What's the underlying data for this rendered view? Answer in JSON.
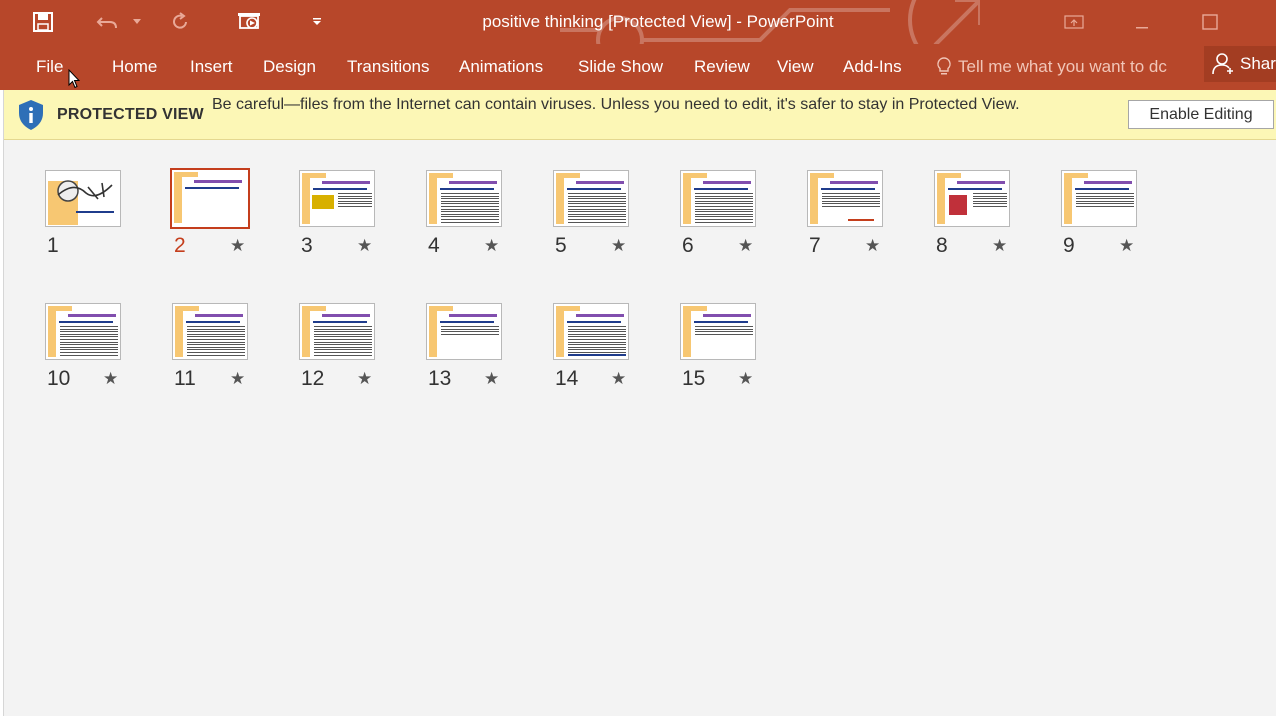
{
  "window": {
    "title": "positive thinking [Protected View] - PowerPoint"
  },
  "qat": {
    "icons": [
      "save-icon",
      "undo-icon",
      "redo-icon",
      "start-from-beginning-icon",
      "customize-icon"
    ]
  },
  "ribbon": {
    "tabs": [
      "File",
      "Home",
      "Insert",
      "Design",
      "Transitions",
      "Animations",
      "Slide Show",
      "Review",
      "View",
      "Add-Ins"
    ],
    "tell_me": "Tell me what you want to dc",
    "share": "Shar"
  },
  "protected_view": {
    "title": "PROTECTED VIEW",
    "message": "Be careful—files from the Internet can contain viruses. Unless you need to edit, it's safer to stay in Protected View.",
    "enable_button": "Enable Editing"
  },
  "slides": [
    {
      "num": "1",
      "star": ""
    },
    {
      "num": "2",
      "star": "★",
      "selected": true
    },
    {
      "num": "3",
      "star": "★"
    },
    {
      "num": "4",
      "star": "★"
    },
    {
      "num": "5",
      "star": "★"
    },
    {
      "num": "6",
      "star": "★"
    },
    {
      "num": "7",
      "star": "★"
    },
    {
      "num": "8",
      "star": "★"
    },
    {
      "num": "9",
      "star": "★"
    },
    {
      "num": "10",
      "star": "★"
    },
    {
      "num": "11",
      "star": "★"
    },
    {
      "num": "12",
      "star": "★"
    },
    {
      "num": "13",
      "star": "★"
    },
    {
      "num": "14",
      "star": "★"
    },
    {
      "num": "15",
      "star": "★"
    }
  ],
  "colors": {
    "accent": "#b7472a",
    "selected": "#c43e1c",
    "protected_bar": "#fcf7b6"
  }
}
